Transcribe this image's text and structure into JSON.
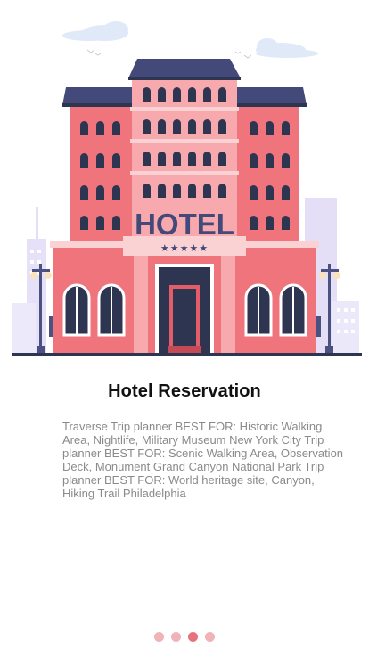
{
  "onboarding": {
    "illustration": {
      "sign_text": "HOTEL",
      "stars": "★★★★★",
      "icon": "hotel-building-illustration"
    },
    "title": "Hotel Reservation",
    "description": "Traverse Trip planner BEST FOR: Historic Walking Area, Nightlife, Military Museum New York City Trip planner BEST FOR: Scenic Walking Area, Observation Deck, Monument Grand Canyon National Park Trip planner BEST FOR: World heritage site, Canyon, Hiking Trail Philadelphia",
    "pagination": {
      "total": 4,
      "active_index": 2
    }
  },
  "colors": {
    "building_main": "#f0747b",
    "building_light": "#f7a9ad",
    "roof": "#434a7a",
    "window": "#2e3551",
    "accent_dot": "#e7727d",
    "inactive_dot": "#f0b3b8",
    "background_city": "#ddd6f5"
  }
}
